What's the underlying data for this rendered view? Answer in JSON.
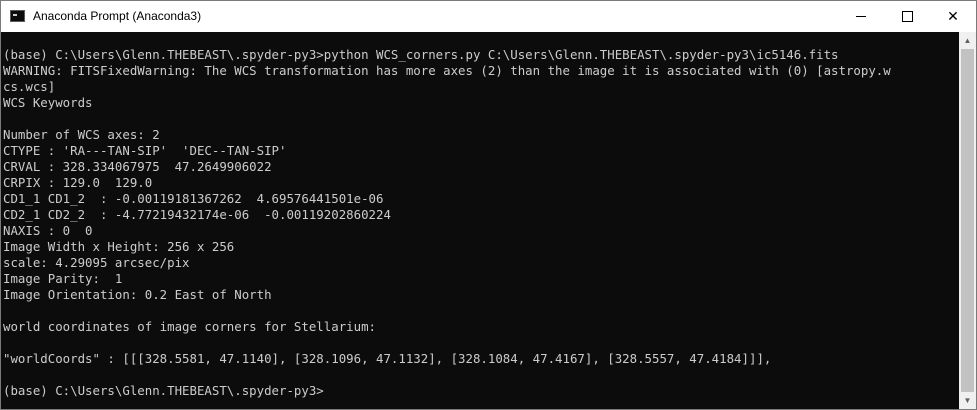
{
  "window": {
    "title": "Anaconda Prompt (Anaconda3)",
    "minimize_icon": "minimize-icon",
    "maximize_icon": "maximize-icon",
    "close_label": "✕"
  },
  "console": {
    "lines": [
      "(base) C:\\Users\\Glenn.THEBEAST\\.spyder-py3>python WCS_corners.py C:\\Users\\Glenn.THEBEAST\\.spyder-py3\\ic5146.fits",
      "WARNING: FITSFixedWarning: The WCS transformation has more axes (2) than the image it is associated with (0) [astropy.w",
      "cs.wcs]",
      "WCS Keywords",
      "",
      "Number of WCS axes: 2",
      "CTYPE : 'RA---TAN-SIP'  'DEC--TAN-SIP'",
      "CRVAL : 328.334067975  47.2649906022",
      "CRPIX : 129.0  129.0",
      "CD1_1 CD1_2  : -0.00119181367262  4.69576441501e-06",
      "CD2_1 CD2_2  : -4.77219432174e-06  -0.00119202860224",
      "NAXIS : 0  0",
      "Image Width x Height: 256 x 256",
      "scale: 4.29095 arcsec/pix",
      "Image Parity:  1",
      "Image Orientation: 0.2 East of North",
      "",
      "world coordinates of image corners for Stellarium:",
      "",
      "\"worldCoords\" : [[[328.5581, 47.1140], [328.1096, 47.1132], [328.1084, 47.4167], [328.5557, 47.4184]]],",
      "",
      "(base) C:\\Users\\Glenn.THEBEAST\\.spyder-py3>"
    ]
  },
  "scrollbar": {
    "up_arrow": "▲",
    "down_arrow": "▼"
  },
  "colors": {
    "console_bg": "#0c0c0c",
    "console_text": "#cccccc",
    "titlebar_bg": "#ffffff"
  }
}
